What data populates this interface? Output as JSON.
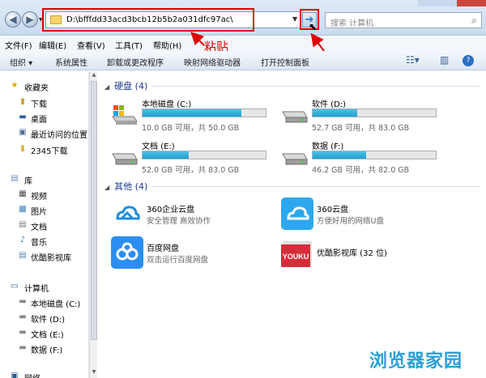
{
  "address": {
    "path": "D:\\bfffdd33acd3bcb12b5b2a031dfc97ac\\",
    "search_placeholder": "搜索 计算机"
  },
  "annotation": {
    "paste_label": "粘贴"
  },
  "menu": [
    "文件(F)",
    "编辑(E)",
    "查看(V)",
    "工具(T)",
    "帮助(H)"
  ],
  "toolbar": {
    "organize": "组织 ▾",
    "system_properties": "系统属性",
    "uninstall": "卸载或更改程序",
    "map_drive": "映射网络驱动器",
    "control_panel": "打开控制面板"
  },
  "sidebar": {
    "favorites": "收藏夹",
    "downloads": "下载",
    "desktop": "桌面",
    "recent": "最近访问的位置",
    "download2345": "2345下载",
    "libraries": "库",
    "videos": "视频",
    "pictures": "图片",
    "documents": "文档",
    "music": "音乐",
    "youku_lib": "优酷影视库",
    "computer": "计算机",
    "drive_c": "本地磁盘 (C:)",
    "drive_d": "软件 (D:)",
    "drive_e": "文档 (E:)",
    "drive_f": "数据 (F:)",
    "network": "网络"
  },
  "groups": {
    "hard_disks": "硬盘 (4)",
    "other": "其他 (4)"
  },
  "drives": [
    {
      "name": "本地磁盘 (C:)",
      "free": "10.0 GB 可用，共 50.0 GB",
      "used_fraction": 0.8
    },
    {
      "name": "软件 (D:)",
      "free": "52.7 GB 可用，共 83.0 GB",
      "used_fraction": 0.365
    },
    {
      "name": "文档 (E:)",
      "free": "52.0 GB 可用，共 83.0 GB",
      "used_fraction": 0.373
    },
    {
      "name": "数据 (F:)",
      "free": "46.2 GB 可用，共 82.0 GB",
      "used_fraction": 0.437
    }
  ],
  "apps": {
    "enterprise_cloud_name": "360企业云盘",
    "enterprise_cloud_desc": "安全管理 高效协作",
    "cloud360_name": "360云盘",
    "cloud360_desc": "方便好用的网络U盘",
    "baidu_name": "百度网盘",
    "baidu_desc": "双击运行百度网盘",
    "youku_name": "优酷影视库 (32 位)",
    "youku_logo": "YOUKU"
  },
  "watermark": "浏览器家园",
  "colors": {
    "accent_blue": "#1e3a8a",
    "highlight_red": "#e00000",
    "drive_fill": "#1ea0cf"
  }
}
